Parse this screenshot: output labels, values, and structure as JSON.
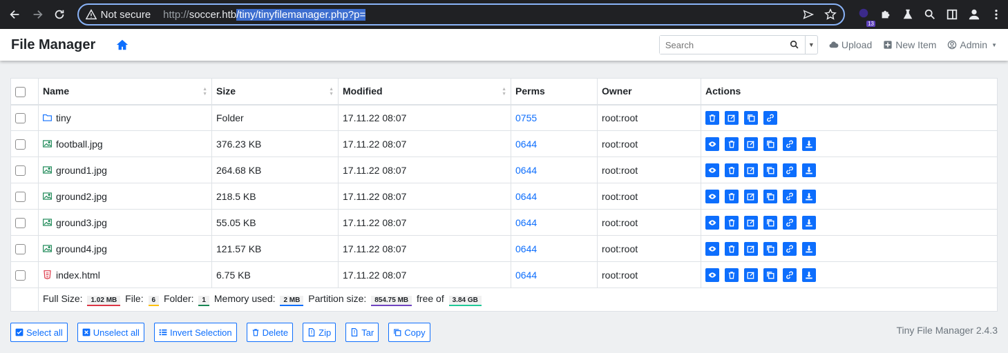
{
  "browser": {
    "not_secure_label": "Not secure",
    "url_scheme": "http://",
    "url_host": "soccer.htb",
    "url_path": "/tiny/tinyfilemanager.php?p=",
    "extension_badge": "13"
  },
  "navbar": {
    "brand": "File Manager",
    "search_placeholder": "Search",
    "upload_label": "Upload",
    "new_item_label": "New Item",
    "admin_label": "Admin"
  },
  "table": {
    "headers": {
      "name": "Name",
      "size": "Size",
      "modified": "Modified",
      "perms": "Perms",
      "owner": "Owner",
      "actions": "Actions"
    },
    "rows": [
      {
        "name": "tiny",
        "type": "folder",
        "size": "Folder",
        "modified": "17.11.22 08:07",
        "perms": "0755",
        "owner": "root:root"
      },
      {
        "name": "football.jpg",
        "type": "image",
        "size": "376.23 KB",
        "modified": "17.11.22 08:07",
        "perms": "0644",
        "owner": "root:root"
      },
      {
        "name": "ground1.jpg",
        "type": "image",
        "size": "264.68 KB",
        "modified": "17.11.22 08:07",
        "perms": "0644",
        "owner": "root:root"
      },
      {
        "name": "ground2.jpg",
        "type": "image",
        "size": "218.5 KB",
        "modified": "17.11.22 08:07",
        "perms": "0644",
        "owner": "root:root"
      },
      {
        "name": "ground3.jpg",
        "type": "image",
        "size": "55.05 KB",
        "modified": "17.11.22 08:07",
        "perms": "0644",
        "owner": "root:root"
      },
      {
        "name": "ground4.jpg",
        "type": "image",
        "size": "121.57 KB",
        "modified": "17.11.22 08:07",
        "perms": "0644",
        "owner": "root:root"
      },
      {
        "name": "index.html",
        "type": "html",
        "size": "6.75 KB",
        "modified": "17.11.22 08:07",
        "perms": "0644",
        "owner": "root:root"
      }
    ],
    "summary": {
      "full_size_label": "Full Size:",
      "full_size": "1.02 MB",
      "file_label": "File:",
      "file_count": "6",
      "folder_label": "Folder:",
      "folder_count": "1",
      "memory_label": "Memory used:",
      "memory": "2 MB",
      "partition_label": "Partition size:",
      "partition": "854.75 MB",
      "free_label": "free of",
      "total": "3.84 GB"
    }
  },
  "bottom": {
    "select_all": "Select all",
    "unselect_all": "Unselect all",
    "invert_selection": "Invert Selection",
    "delete": "Delete",
    "zip": "Zip",
    "tar": "Tar",
    "copy": "Copy",
    "version": "Tiny File Manager 2.4.3"
  },
  "colors": {
    "accent": "#0d6efd",
    "full_size_underline": "#dc3545",
    "file_underline": "#ffc107",
    "folder_underline": "#198754",
    "memory_underline": "#0d6efd",
    "partition_underline": "#6f42c1",
    "total_underline": "#20c997"
  }
}
